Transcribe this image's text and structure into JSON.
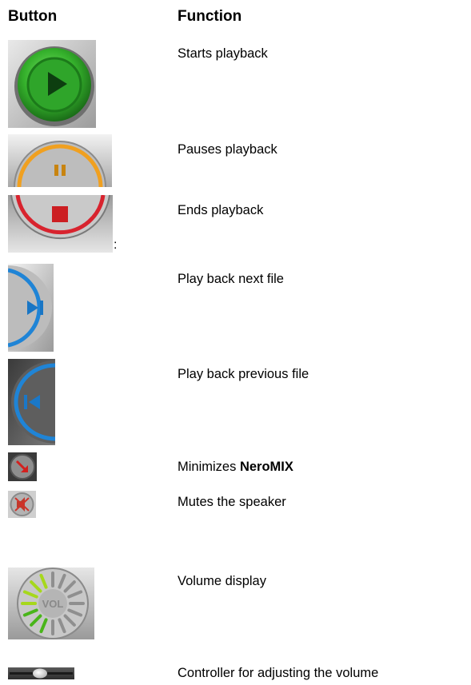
{
  "header": {
    "button": "Button",
    "function": "Function"
  },
  "rows": [
    {
      "icon": "play-button-icon",
      "desc": "Starts playback"
    },
    {
      "icon": "pause-button-icon",
      "desc": "Pauses playback"
    },
    {
      "icon": "stop-button-icon",
      "desc": "Ends playback",
      "trailing": ":"
    },
    {
      "icon": "next-file-button-icon",
      "desc": "Play back next file"
    },
    {
      "icon": "previous-file-button-icon",
      "desc": "Play back previous file"
    },
    {
      "icon": "minimize-button-icon",
      "desc_prefix": "Minimizes ",
      "desc_bold": "NeroMIX"
    },
    {
      "icon": "mute-button-icon",
      "desc": "Mutes the speaker"
    },
    {
      "icon": "volume-display-icon",
      "desc": "Volume display"
    },
    {
      "icon": "volume-slider-icon",
      "desc": "Controller for adjusting the volume"
    }
  ],
  "volume_display": {
    "label": "VOL"
  }
}
